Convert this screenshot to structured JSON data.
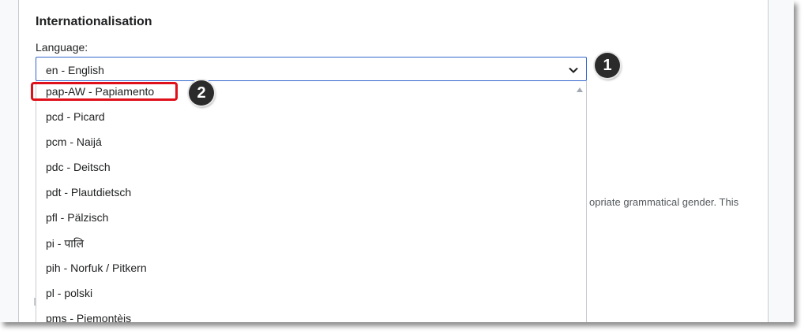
{
  "section": {
    "title": "Internationalisation"
  },
  "language_field": {
    "label": "Language:",
    "selected_value": "en - English"
  },
  "dropdown": {
    "options": [
      "pap-AW - Papiamento",
      "pcd - Picard",
      "pcm - Naijá",
      "pdc - Deitsch",
      "pdt - Plautdietsch",
      "pfl - Pälzisch",
      "pi - पालि",
      "pih - Norfuk / Pitkern",
      "pl - polski",
      "pms - Piemontèis"
    ]
  },
  "background_text": "opriate grammatical gender. This",
  "callouts": [
    "1",
    "2"
  ],
  "colors": {
    "focus_border": "#3366cc",
    "highlight_red": "#e0101a",
    "callout_bg": "#2b2b2b"
  }
}
